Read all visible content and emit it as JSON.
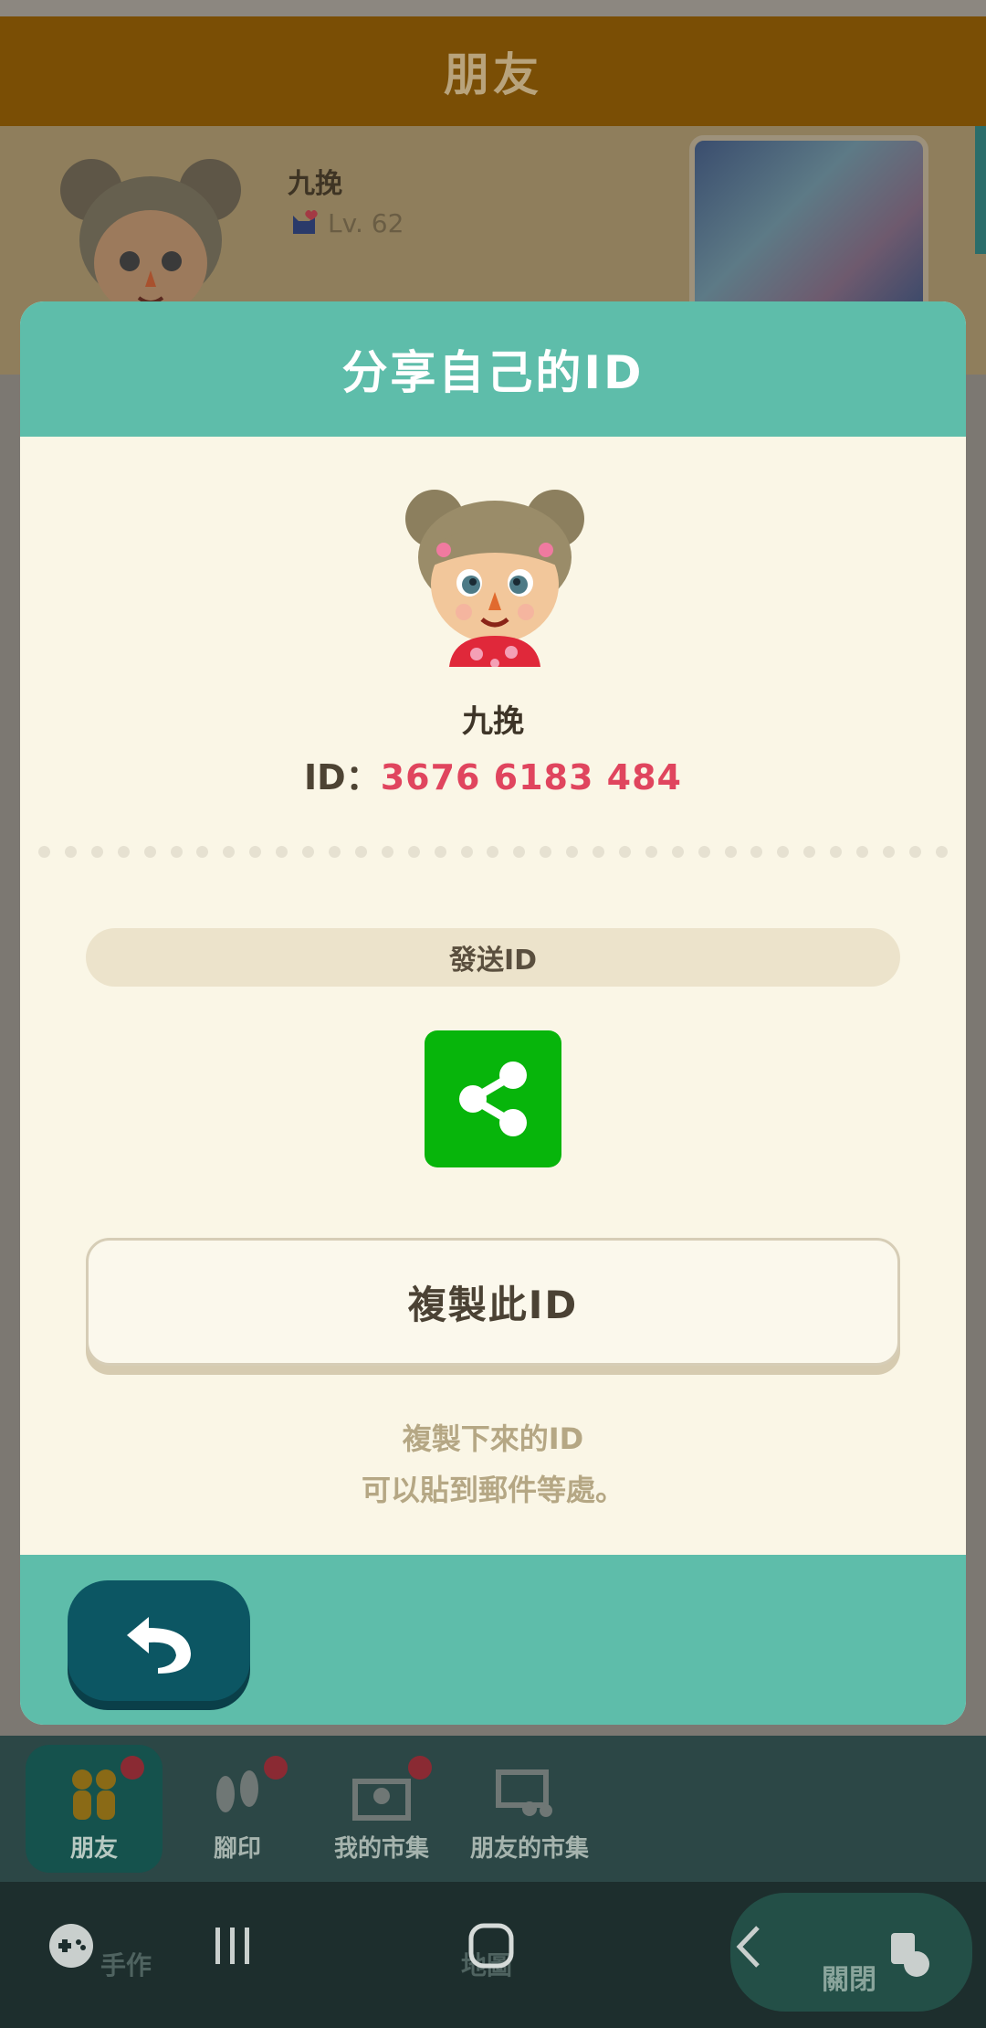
{
  "header": {
    "title": "朋友"
  },
  "profile": {
    "name": "九挽",
    "level": "Lv. 62"
  },
  "modal": {
    "title": "分享自己的ID",
    "user_name": "九挽",
    "id_prefix": "ID：",
    "id_value": "3676 6183 484",
    "send_label": "發送ID",
    "copy_label": "複製此ID",
    "note_line1": "複製下來的ID",
    "note_line2": "可以貼到郵件等處。"
  },
  "tabs": [
    {
      "label": "朋友",
      "icon": "friends-icon",
      "badge": true
    },
    {
      "label": "腳印",
      "icon": "footprint-icon",
      "badge": true
    },
    {
      "label": "我的市集",
      "icon": "market-icon",
      "badge": true
    },
    {
      "label": "朋友的市集",
      "icon": "friends-market-icon",
      "badge": false
    }
  ],
  "bottom_bar": {
    "craft_label": "手作",
    "map_label": "地圖",
    "close_label": "關閉"
  },
  "colors": {
    "teal_header": "#5ebdaa",
    "id_pink": "#e0455e",
    "share_green": "#07b50b",
    "back_button": "#0c5663"
  }
}
